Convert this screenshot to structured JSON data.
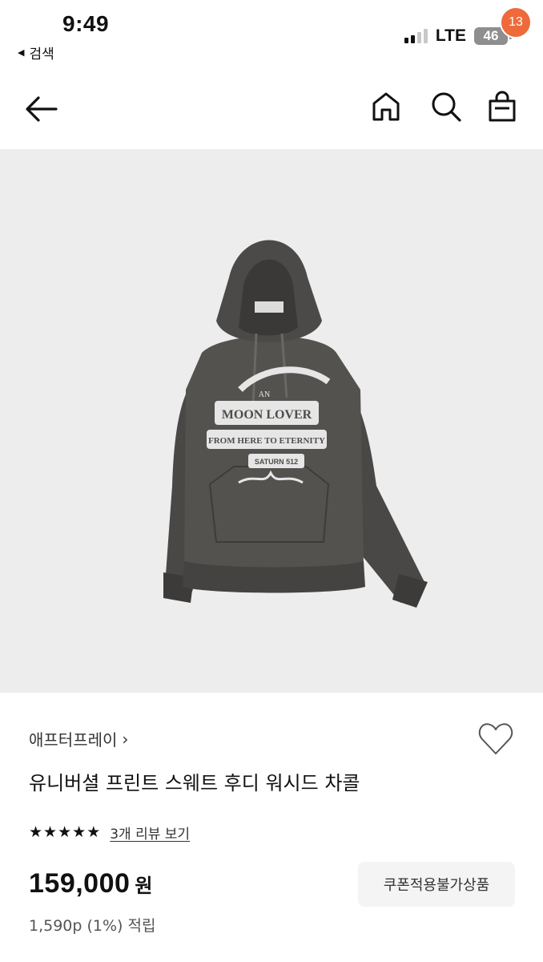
{
  "status_bar": {
    "time": "9:49",
    "back_app": "검색",
    "network": "LTE",
    "battery": "46"
  },
  "header": {
    "cart_count": "13"
  },
  "product": {
    "image_print": {
      "line1": "AN",
      "line2": "MOON LOVER",
      "line3": "FROM HERE TO ETERNITY",
      "line4": "SATURN 512"
    },
    "brand": "애프터프레이",
    "title": "유니버셜 프린트 스웨트 후디 워시드 차콜",
    "rating_stars": 5,
    "review_link": "3개 리뷰 보기",
    "price": "159,000",
    "price_unit": "원",
    "coupon_note": "쿠폰적용불가상품",
    "points": "1,590p (1%) 적립"
  },
  "icons": [
    "back-arrow-icon",
    "home-icon",
    "search-icon",
    "shopping-bag-icon",
    "heart-icon",
    "star-icon"
  ],
  "colors": {
    "badge": "#ee6a3a",
    "image_bg": "#ededed",
    "hoodie": "#4f4d4b",
    "coupon_bg": "#f4f4f4"
  }
}
